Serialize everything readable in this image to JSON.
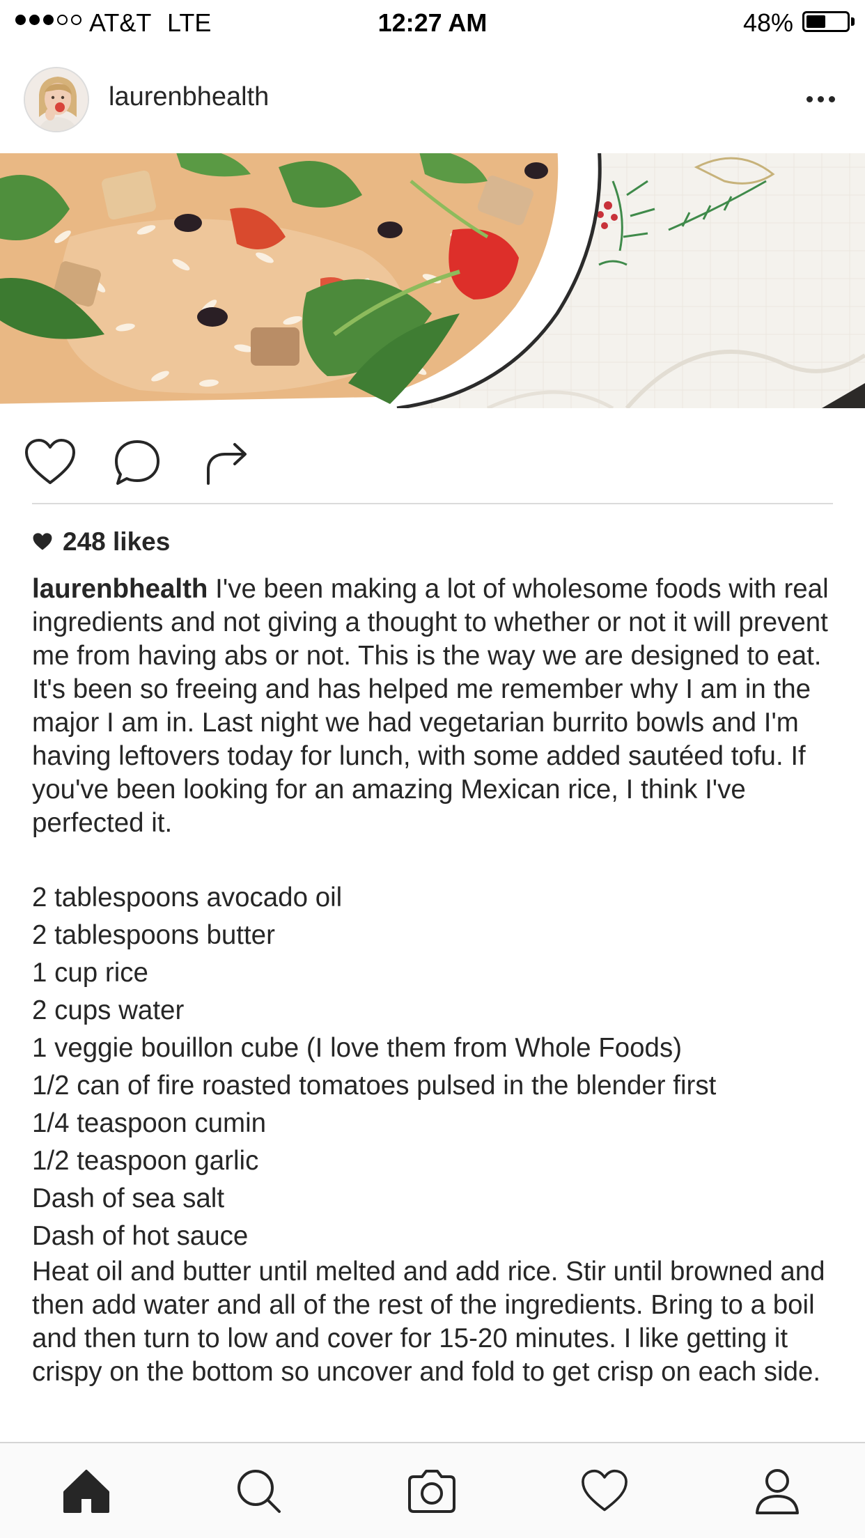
{
  "status_bar": {
    "signal_bars_filled": 3,
    "signal_bars_total": 5,
    "carrier": "AT&T",
    "network": "LTE",
    "time": "12:27 AM",
    "battery_percent": "48%",
    "battery_level": 0.48
  },
  "post": {
    "username": "laurenbhealth",
    "more_icon": "more-horizontal-icon",
    "likes": "248 likes",
    "caption_user": "laurenbhealth",
    "caption_text": "I've been making a lot of wholesome foods with real ingredients and not giving a thought to whether or not it will prevent me from having abs or not. This is the way we are designed to eat. It's been so freeing and has helped me remember why I am in the major I am in. Last night we had vegetarian burrito bowls and I'm having leftovers today for lunch, with some added sautéed tofu. If you've been looking for an amazing Mexican rice, I think I've perfected it.",
    "ingredients": [
      "2 tablespoons avocado oil",
      "2 tablespoons butter",
      "1 cup rice",
      "2 cups water",
      "1 veggie bouillon cube (I love them from Whole Foods)",
      "1/2 can of fire roasted tomatoes pulsed in the blender first",
      "1/4 teaspoon cumin",
      "1/2 teaspoon garlic",
      "Dash of sea salt",
      "Dash of hot sauce"
    ],
    "method": "Heat oil and butter until melted and add rice. Stir until browned and then add water and all of the rest of the ingredients. Bring to a boil and then turn to low and cover for 15-20 minutes. I like getting it crispy on the bottom so uncover and fold to get crisp on each side."
  },
  "actions": [
    "heart-icon",
    "comment-icon",
    "share-icon"
  ],
  "tab_bar": [
    "home-icon",
    "search-icon",
    "camera-icon",
    "activity-heart-icon",
    "profile-icon"
  ],
  "colors": {
    "text": "#262626",
    "divider": "#dbdbdb",
    "tab_bar_bg": "#fafafa"
  }
}
